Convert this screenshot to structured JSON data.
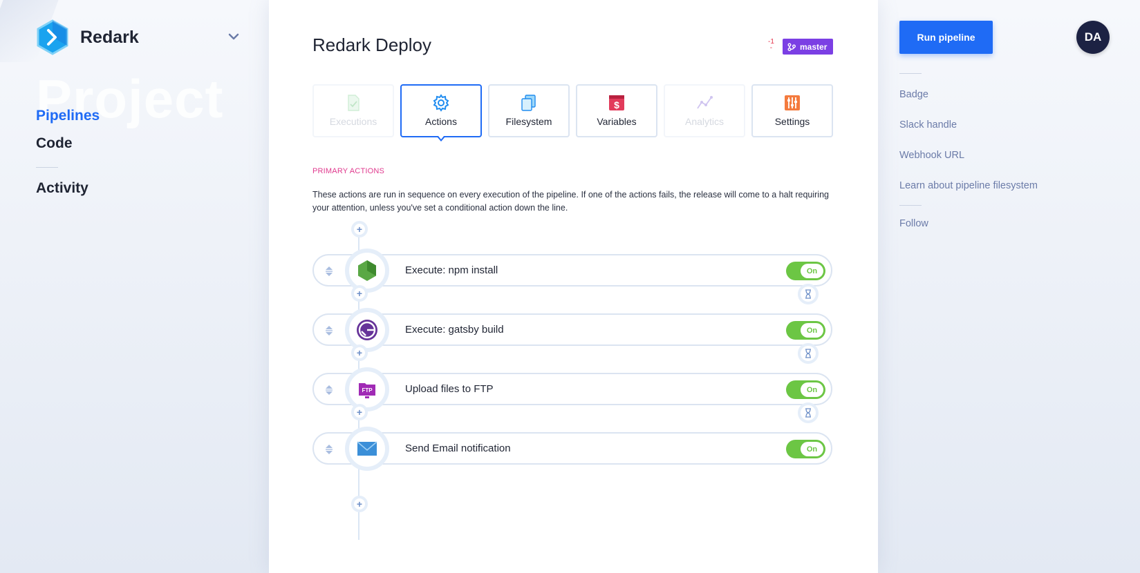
{
  "brand": {
    "name": "Redark",
    "watermark": "Project"
  },
  "nav": {
    "items": [
      {
        "label": "Pipelines",
        "active": true
      },
      {
        "label": "Code",
        "active": false
      }
    ],
    "secondary": [
      {
        "label": "Activity"
      }
    ]
  },
  "header": {
    "title": "Redark Deploy",
    "diff_count": "-1",
    "branch": "master"
  },
  "tabs": [
    {
      "label": "Executions",
      "icon": "file-check-icon",
      "state": "disabled"
    },
    {
      "label": "Actions",
      "icon": "gear-icon",
      "state": "active"
    },
    {
      "label": "Filesystem",
      "icon": "files-icon",
      "state": "normal"
    },
    {
      "label": "Variables",
      "icon": "dollar-icon",
      "state": "normal"
    },
    {
      "label": "Analytics",
      "icon": "chart-line-icon",
      "state": "disabled"
    },
    {
      "label": "Settings",
      "icon": "sliders-icon",
      "state": "normal"
    }
  ],
  "section": {
    "title": "PRIMARY ACTIONS",
    "description": "These actions are run in sequence on every execution of the pipeline. If one of the actions fails, the release will come to a halt requiring your attention, unless you've set a conditional action down the line."
  },
  "actions": [
    {
      "label": "Execute: npm install",
      "icon": "nodejs-icon",
      "toggle": "On"
    },
    {
      "label": "Execute: gatsby build",
      "icon": "gatsby-icon",
      "toggle": "On"
    },
    {
      "label": "Upload files to FTP",
      "icon": "ftp-icon",
      "toggle": "On"
    },
    {
      "label": "Send Email notification",
      "icon": "email-icon",
      "toggle": "On"
    }
  ],
  "right": {
    "run_button": "Run pipeline",
    "avatar_initials": "DA",
    "links": [
      "Badge",
      "Slack handle",
      "Webhook URL",
      "Learn about pipeline filesystem"
    ],
    "follow": "Follow"
  },
  "colors": {
    "accent": "#1f6bf5",
    "branch": "#7b3fe4",
    "toggle_on": "#6cc644",
    "section_title": "#e03a8e"
  }
}
